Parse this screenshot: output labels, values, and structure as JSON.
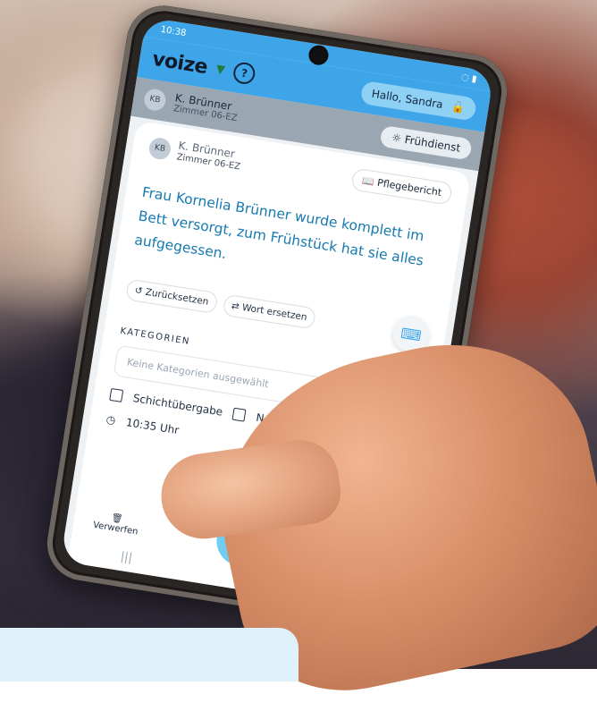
{
  "status": {
    "time": "10:38"
  },
  "app": {
    "logo": "voize",
    "greeting": "Hallo, Sandra"
  },
  "patient": {
    "initials": "KB",
    "name": "K. Brünner",
    "room": "Zimmer 06-EZ",
    "shift": "Frühdienst"
  },
  "card": {
    "report_button": "Pflegebericht",
    "text": "Frau Kornelia Brünner wurde komplett im Bett versorgt, zum Frühstück hat sie alles aufgegessen.",
    "reset": "Zurücksetzen",
    "replace": "Wort ersetzen",
    "categories_title": "KATEGORIEN",
    "categories_placeholder": "Keine Kategorien ausgewählt",
    "handover": "Schichtübergabe",
    "emergency": "Notfallblatt",
    "time": "10:35 Uhr",
    "discard": "Verwerfen"
  },
  "colors": {
    "brand": "#3ea6e8",
    "text_accent": "#167ab1"
  }
}
